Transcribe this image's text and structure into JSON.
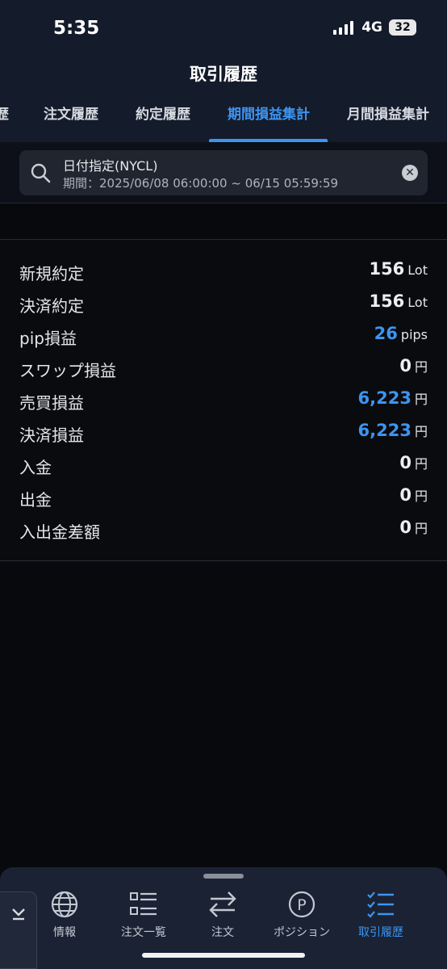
{
  "status_bar": {
    "time": "5:35",
    "network": "4G",
    "battery": "32"
  },
  "header": {
    "title": "取引履歴"
  },
  "tabs": [
    {
      "label": "歴"
    },
    {
      "label": "注文履歴"
    },
    {
      "label": "約定履歴"
    },
    {
      "label": "期間損益集計",
      "active": true
    },
    {
      "label": "月間損益集計"
    }
  ],
  "search": {
    "title": "日付指定(NYCL)",
    "period": "期間：2025/06/08 06:00:00 ~ 06/15 05:59:59"
  },
  "summary": [
    {
      "label": "新規約定",
      "value": "156",
      "unit": "Lot"
    },
    {
      "label": "決済約定",
      "value": "156",
      "unit": "Lot"
    },
    {
      "label": "pip損益",
      "value": "26",
      "unit": "pips",
      "highlight": true
    },
    {
      "label": "スワップ損益",
      "value": "0",
      "unit": "円"
    },
    {
      "label": "売買損益",
      "value": "6,223",
      "unit": "円",
      "highlight": true
    },
    {
      "label": "決済損益",
      "value": "6,223",
      "unit": "円",
      "highlight": true
    },
    {
      "label": "入金",
      "value": "0",
      "unit": "円"
    },
    {
      "label": "出金",
      "value": "0",
      "unit": "円"
    },
    {
      "label": "入出金差額",
      "value": "0",
      "unit": "円"
    }
  ],
  "bottom_nav": [
    {
      "label": "情報",
      "icon": "globe-icon"
    },
    {
      "label": "注文一覧",
      "icon": "list-icon"
    },
    {
      "label": "注文",
      "icon": "swap-arrows-icon"
    },
    {
      "label": "ポジション",
      "icon": "position-p-icon"
    },
    {
      "label": "取引履歴",
      "icon": "checklist-icon",
      "active": true
    }
  ],
  "colors": {
    "accent": "#3d94f0",
    "header_bg": "#141b2b",
    "page_bg": "#07090d"
  }
}
